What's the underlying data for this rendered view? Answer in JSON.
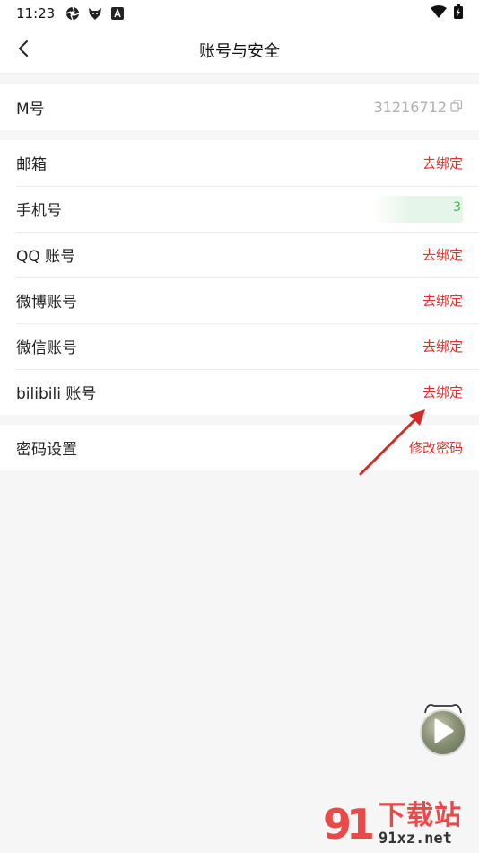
{
  "status_bar": {
    "time": "11:23",
    "icons": [
      "aperture-icon",
      "fox-icon",
      "app-a-icon"
    ],
    "right_icons": [
      "wifi-icon",
      "battery-icon"
    ]
  },
  "header": {
    "title": "账号与安全",
    "back_icon": "chevron-left-icon"
  },
  "account_id": {
    "label": "M号",
    "value": "31216712",
    "copy_icon": "copy-icon"
  },
  "bindings": [
    {
      "label": "邮箱",
      "action": "去绑定"
    },
    {
      "label": "手机号",
      "value_tail": "3"
    },
    {
      "label": "QQ 账号",
      "action": "去绑定"
    },
    {
      "label": "微博账号",
      "action": "去绑定"
    },
    {
      "label": "微信账号",
      "action": "去绑定"
    },
    {
      "label": "bilibili 账号",
      "action": "去绑定"
    }
  ],
  "password": {
    "label": "密码设置",
    "action": "修改密码"
  },
  "watermark": {
    "logo": "91",
    "name": "下载站",
    "url": "91xz.net"
  },
  "colors": {
    "accent_red": "#e3312d",
    "background": "#f6f6f6",
    "card": "#ffffff",
    "gray_text": "#b0b0b0"
  }
}
